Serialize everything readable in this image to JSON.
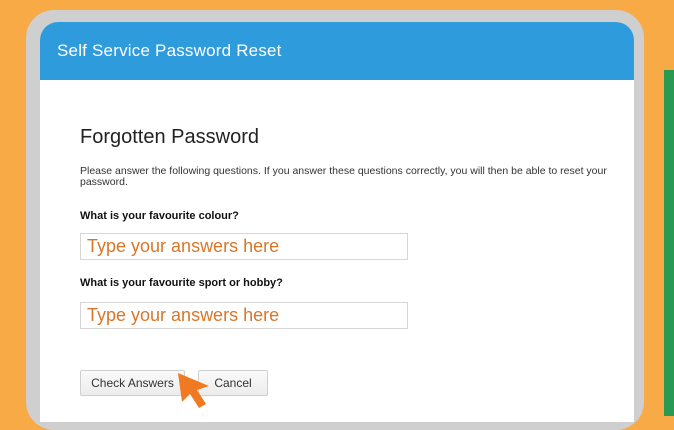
{
  "window": {
    "title": "Self Service Password Reset"
  },
  "form": {
    "heading": "Forgotten Password",
    "instructions": "Please answer the following questions. If you answer these questions correctly, you will then be able to reset your password.",
    "questions": [
      {
        "label": "What is your favourite colour?",
        "placeholder": "Type your answers here"
      },
      {
        "label": "What is your favourite sport or hobby?",
        "placeholder": "Type your answers here"
      }
    ],
    "buttons": {
      "check": "Check Answers",
      "cancel": "Cancel"
    }
  },
  "colors": {
    "background": "#f7aa45",
    "titlebar": "#2e9bdd",
    "placeholder_text": "#d9762a",
    "cursor": "#ef7a22"
  },
  "icons": {
    "cursor": "pointer-arrow-icon"
  }
}
